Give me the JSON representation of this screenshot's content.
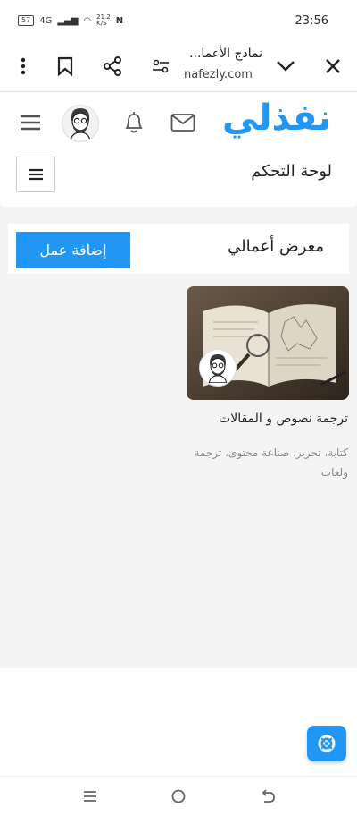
{
  "status_bar": {
    "time": "23:56",
    "battery": "57",
    "network": "4G",
    "speed": "21.2\nK/S"
  },
  "browser": {
    "page_title": "نماذج الأعما...",
    "url": "nafezly.com",
    "icons": [
      "close-icon",
      "chevron-down-icon",
      "tune-icon",
      "share-icon",
      "bookmark-icon",
      "more-vert-icon"
    ]
  },
  "site": {
    "logo": "نفذلي",
    "nav_icons": [
      "mail-icon",
      "bell-icon",
      "avatar",
      "hamburger-icon"
    ]
  },
  "dashboard": {
    "title": "لوحة التحكم"
  },
  "portfolio": {
    "title": "معرض أعمالي",
    "add_button": "إضافة عمل",
    "items": [
      {
        "title": "ترجمة نصوص و المقالات",
        "tags": "كتابة، تحرير، صناعة محتوى، ترجمة ولغات"
      }
    ]
  },
  "colors": {
    "accent": "#2196f3",
    "background": "#f4f4f4"
  }
}
